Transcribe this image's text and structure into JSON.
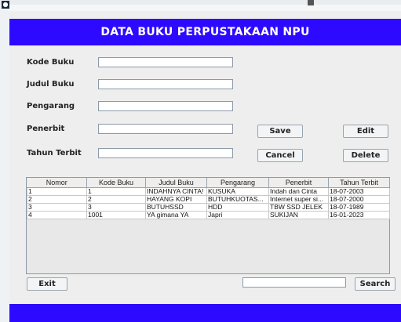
{
  "window": {
    "title": "DATA BUKU PERPUSTAKAAN NPU"
  },
  "form": {
    "kode_label": "Kode Buku",
    "judul_label": "Judul Buku",
    "pengarang_label": "Pengarang",
    "penerbit_label": "Penerbit",
    "tahun_label": "Tahun Terbit",
    "kode_value": "",
    "judul_value": "",
    "pengarang_value": "",
    "penerbit_value": "",
    "tahun_value": ""
  },
  "buttons": {
    "save": "Save",
    "edit": "Edit",
    "cancel": "Cancel",
    "delete": "Delete",
    "exit": "Exit",
    "search": "Search"
  },
  "search": {
    "value": ""
  },
  "table": {
    "columns": [
      "Nomor",
      "Kode Buku",
      "Judul Buku",
      "Pengarang",
      "Penerbit",
      "Tahun Terbit"
    ],
    "rows": [
      [
        "1",
        "1",
        "INDAHNYA CINTA!",
        "KUSUKA",
        "Indah dan Cinta",
        "18-07-2003"
      ],
      [
        "2",
        "2",
        "HAYANG KOPI",
        "BUTUHKUOTAS...",
        "Internet super si...",
        "18-07-2000"
      ],
      [
        "3",
        "3",
        "BUTUHSSD",
        "HDD",
        "TBW SSD JELEK",
        "18-07-1989"
      ],
      [
        "4",
        "1001",
        "YA gimana YA",
        "Japri",
        "SUKIJAN",
        "16-01-2023"
      ]
    ]
  },
  "colors": {
    "header_bg": "#2d0aff",
    "header_text": "#ffffff",
    "window_bg": "#eeeeee"
  }
}
